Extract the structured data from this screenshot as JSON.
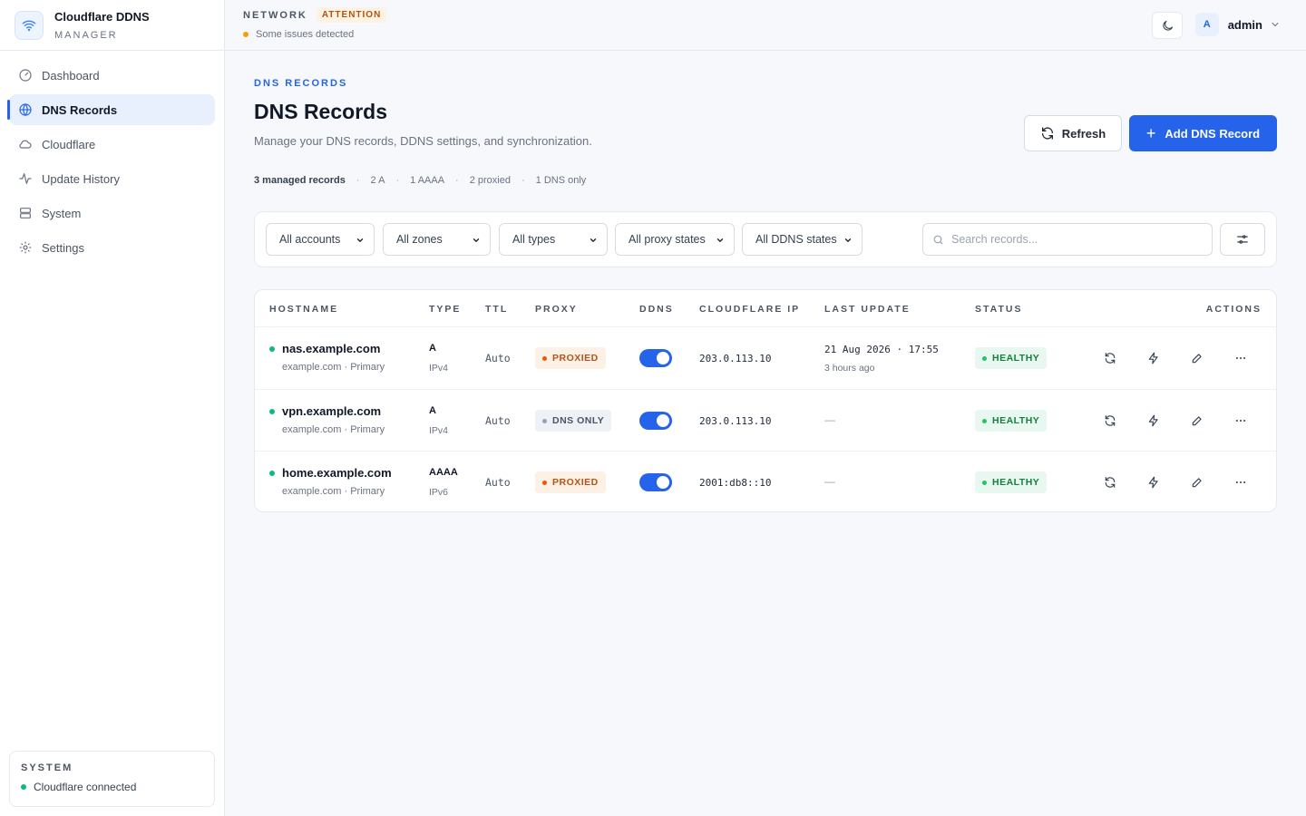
{
  "brand": {
    "title": "Cloudflare DDNS",
    "subtitle": "MANAGER"
  },
  "sidebar": {
    "items": [
      {
        "label": "Dashboard",
        "icon": "gauge-icon"
      },
      {
        "label": "DNS Records",
        "icon": "globe-icon",
        "active": true
      },
      {
        "label": "Cloudflare",
        "icon": "cloud-icon"
      },
      {
        "label": "Update History",
        "icon": "activity-icon"
      },
      {
        "label": "System",
        "icon": "server-icon"
      },
      {
        "label": "Settings",
        "icon": "gear-icon"
      }
    ],
    "system": {
      "label": "SYSTEM",
      "status": "Cloudflare connected",
      "status_color": "#10b981"
    }
  },
  "topbar": {
    "network_label": "NETWORK",
    "attention_badge": "ATTENTION",
    "issue_text": "Some issues detected",
    "issue_color": "#f59e0b",
    "user": {
      "initial": "A",
      "name": "admin"
    }
  },
  "header": {
    "eyebrow": "DNS RECORDS",
    "title": "DNS Records",
    "description": "Manage your DNS records, DDNS settings, and synchronization.",
    "refresh_label": "Refresh",
    "add_label": "Add DNS Record"
  },
  "summary": {
    "managed": "3 managed records",
    "a_count": "2 A",
    "aaaa_count": "1 AAAA",
    "proxied_count": "2 proxied",
    "dns_only_count": "1 DNS only"
  },
  "filters": {
    "accounts": "All accounts",
    "zones": "All zones",
    "types": "All types",
    "proxy_states": "All proxy states",
    "ddns_states": "All DDNS states",
    "search_placeholder": "Search records..."
  },
  "table": {
    "columns": {
      "hostname": "HOSTNAME",
      "type": "TYPE",
      "ttl": "TTL",
      "proxy": "PROXY",
      "ddns": "DDNS",
      "cloudflare_ip": "CLOUDFLARE IP",
      "last_update": "LAST UPDATE",
      "status": "STATUS",
      "actions": "ACTIONS"
    },
    "rows": [
      {
        "hostname": "nas.example.com",
        "zone": "example.com · Primary",
        "type": "A",
        "ip_version": "IPv4",
        "ttl": "Auto",
        "proxy": "PROXIED",
        "ddns_enabled": true,
        "ip": "203.0.113.10",
        "last_update": "21 Aug 2026 · 17:55",
        "last_update_relative": "3 hours ago",
        "status": "HEALTHY"
      },
      {
        "hostname": "vpn.example.com",
        "zone": "example.com · Primary",
        "type": "A",
        "ip_version": "IPv4",
        "ttl": "Auto",
        "proxy": "DNS ONLY",
        "ddns_enabled": true,
        "ip": "203.0.113.10",
        "last_update": "—",
        "last_update_relative": "",
        "status": "HEALTHY"
      },
      {
        "hostname": "home.example.com",
        "zone": "example.com · Primary",
        "type": "AAAA",
        "ip_version": "IPv6",
        "ttl": "Auto",
        "proxy": "PROXIED",
        "ddns_enabled": true,
        "ip": "2001:db8::10",
        "last_update": "—",
        "last_update_relative": "",
        "status": "HEALTHY"
      }
    ]
  },
  "colors": {
    "accent": "#2563eb",
    "healthy": "#15803d",
    "proxied": "#b4531b"
  }
}
